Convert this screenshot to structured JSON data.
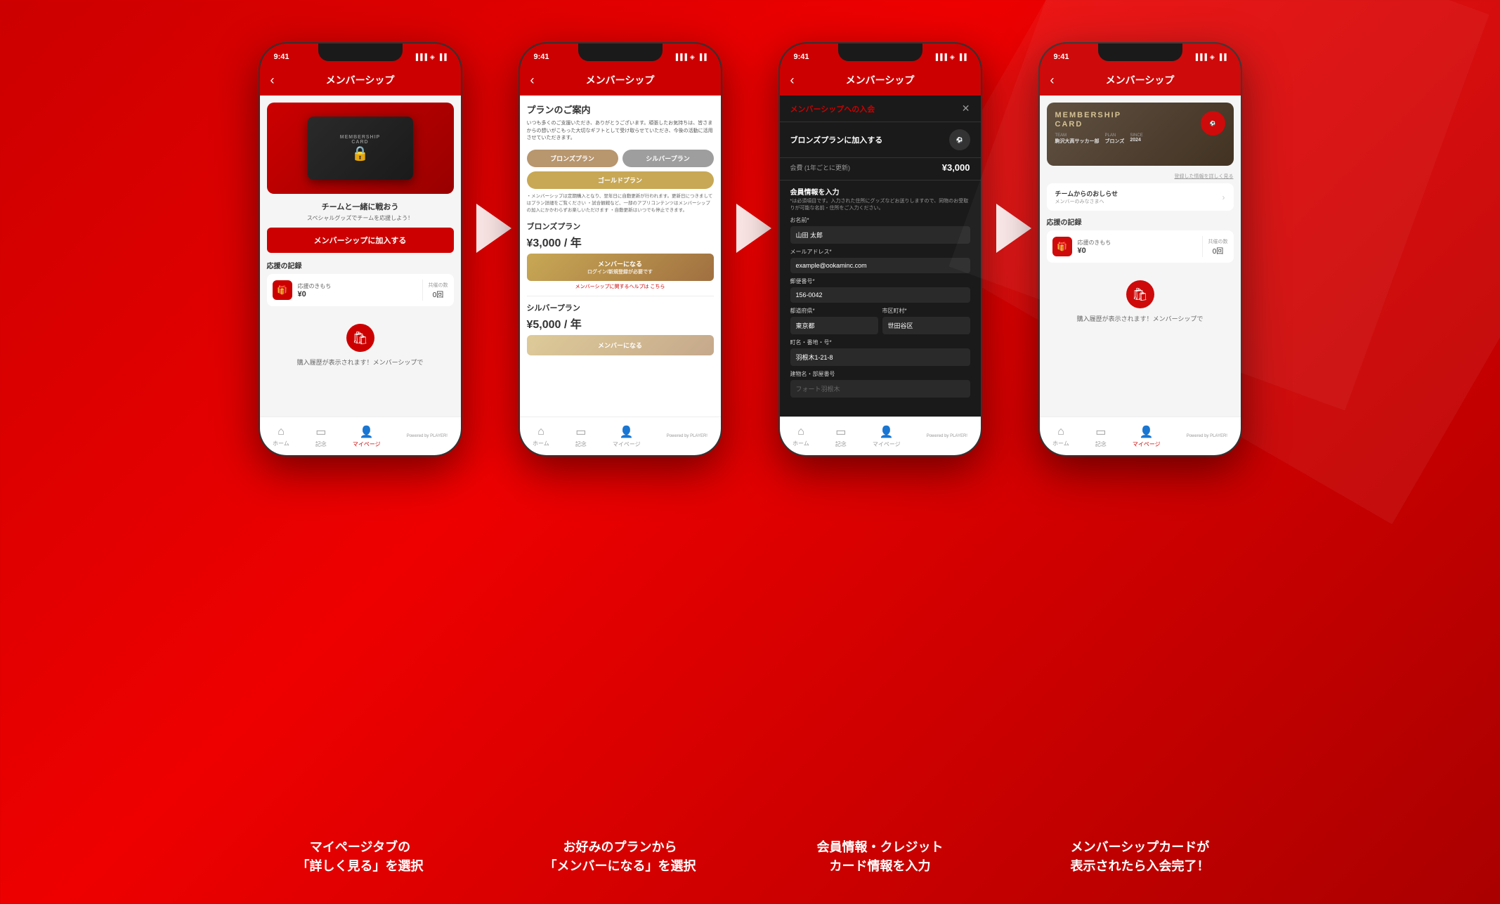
{
  "background": {
    "color": "#cc0000"
  },
  "phones": [
    {
      "id": "phone1",
      "status_bar": {
        "time": "9:41",
        "icons": "▐▐▐ ◈ ▐▐"
      },
      "header": {
        "title": "メンバーシップ",
        "back": "‹"
      },
      "card": {
        "text1": "MEMBERSHIP",
        "text2": "CARD",
        "lock": "🔒"
      },
      "subtitle": "チームと一緒に戦おう",
      "subdesc": "スペシャルグッズでチームを応援しよう！",
      "join_button": "メンバーシップに加入する",
      "support_title": "応援の記録",
      "support_label": "応援のきもち",
      "support_amount": "¥0",
      "count_label": "共催の数",
      "count_value": "0回",
      "purchase_text": "購入履歴が表示されます！メンバーシップで",
      "nav": {
        "home": "ホーム",
        "news": "記念",
        "mypage": "マイページ",
        "powered": "Powered by PLAYER!"
      }
    },
    {
      "id": "phone2",
      "status_bar": {
        "time": "9:41",
        "icons": "▐▐▐ ◈ ▐▐"
      },
      "header": {
        "title": "メンバーシップ",
        "back": "‹"
      },
      "plan_guide_title": "プランのご案内",
      "plan_guide_desc": "いつも多くのご支援いただき、ありがとうございます。頑張したお気持ちは、皆さまからの想いがこもった大切なギフトとして受け取らせていただき、今後の活動に活用させていただきます。",
      "btn_bronze": "ブロンズプラン",
      "btn_silver": "シルバープラン",
      "btn_gold": "ゴールドプラン",
      "notes": "・メンバーシップは定期購入となり、翌年日に自動更新が行われます。更新日につきましてはプラン詳細をご覧ください\n・試合観戦など、一部のアプリコンテンツはメンバーシップの加入にかかわらずお楽しいただけます\n・自動更新はいつでも停止できます。",
      "bronze_title": "ブロンズプラン",
      "bronze_price": "¥3,000 / 年",
      "bronze_btn": "メンバーになる",
      "bronze_btn_sub": "ログイン/新規登録が必要です",
      "help_text": "メンバーシップに関するヘルプは",
      "help_link": "こちら",
      "silver_title": "シルバープラン",
      "silver_price": "¥5,000 / 年",
      "silver_btn": "メンバーになる",
      "nav": {
        "home": "ホーム",
        "news": "記念",
        "mypage": "マイページ",
        "powered": "Powered by PLAYER!"
      }
    },
    {
      "id": "phone3",
      "status_bar": {
        "time": "9:41",
        "icons": "▐▐▐ ◈ ▐▐"
      },
      "header": {
        "title": "メンバーシップ",
        "back": "‹"
      },
      "modal_title": "メンバーシップへの入会",
      "modal_close": "✕",
      "plan_name": "ブロンズプランに加入する",
      "fee_label": "会費 (1年ごとに更新)",
      "fee_amount": "¥3,000",
      "form_title": "会員情報を入力",
      "form_note": "*は必須項目です。入力された住所にグッズなどお送りしますので、同物のお受取りが可能な名前・住所をご入力ください。",
      "name_label": "お名前*",
      "name_value": "山田 太郎",
      "email_label": "メールアドレス*",
      "email_value": "example@ookaminc.com",
      "postal_label": "郵便番号*",
      "postal_value": "156-0042",
      "prefecture_label": "都道府県*",
      "prefecture_value": "東京都",
      "city_label": "市区町村*",
      "city_value": "世田谷区",
      "address_label": "町名・番地・号*",
      "address_value": "羽根木1-21-8",
      "building_label": "建物名・部屋番号",
      "building_placeholder": "フォート羽根木",
      "nav": {
        "home": "ホーム",
        "news": "記念",
        "mypage": "マイページ",
        "powered": "Powered by PLAYER!"
      }
    },
    {
      "id": "phone4",
      "status_bar": {
        "time": "9:41",
        "icons": "▐▐▐ ◈ ▐▐"
      },
      "header": {
        "title": "メンバーシップ",
        "back": "‹"
      },
      "card_title1": "MEMBERSHIP",
      "card_title2": "CARD",
      "card_team_label": "TEAM",
      "card_team_value": "駒沢大高サッカー部",
      "card_plan_label": "PLAN",
      "card_plan_value": "ブロンズ",
      "card_since_label": "SINCE",
      "card_since_value": "2024",
      "card_detail_link": "登録した情報を詳しく見る",
      "news_title": "チームからのおしらせ",
      "news_sub": "メンバーのみなさまへ",
      "support_title": "応援の記録",
      "support_label": "応援のきもち",
      "support_amount": "¥0",
      "count_label": "共催の数",
      "count_value": "0回",
      "purchase_text": "購入履歴が表示されます！メンバーシップで",
      "nav": {
        "home": "ホーム",
        "news": "記念",
        "mypage": "マイページ",
        "powered": "Powered by PLAYER!"
      }
    }
  ],
  "captions": [
    "マイページタブの\n「詳しく見る」を選択",
    "お好みのプランから\n「メンバーになる」を選択",
    "会員情報・クレジット\nカード情報を入力",
    "メンバーシップカードが\n表示されたら入会完了！"
  ]
}
